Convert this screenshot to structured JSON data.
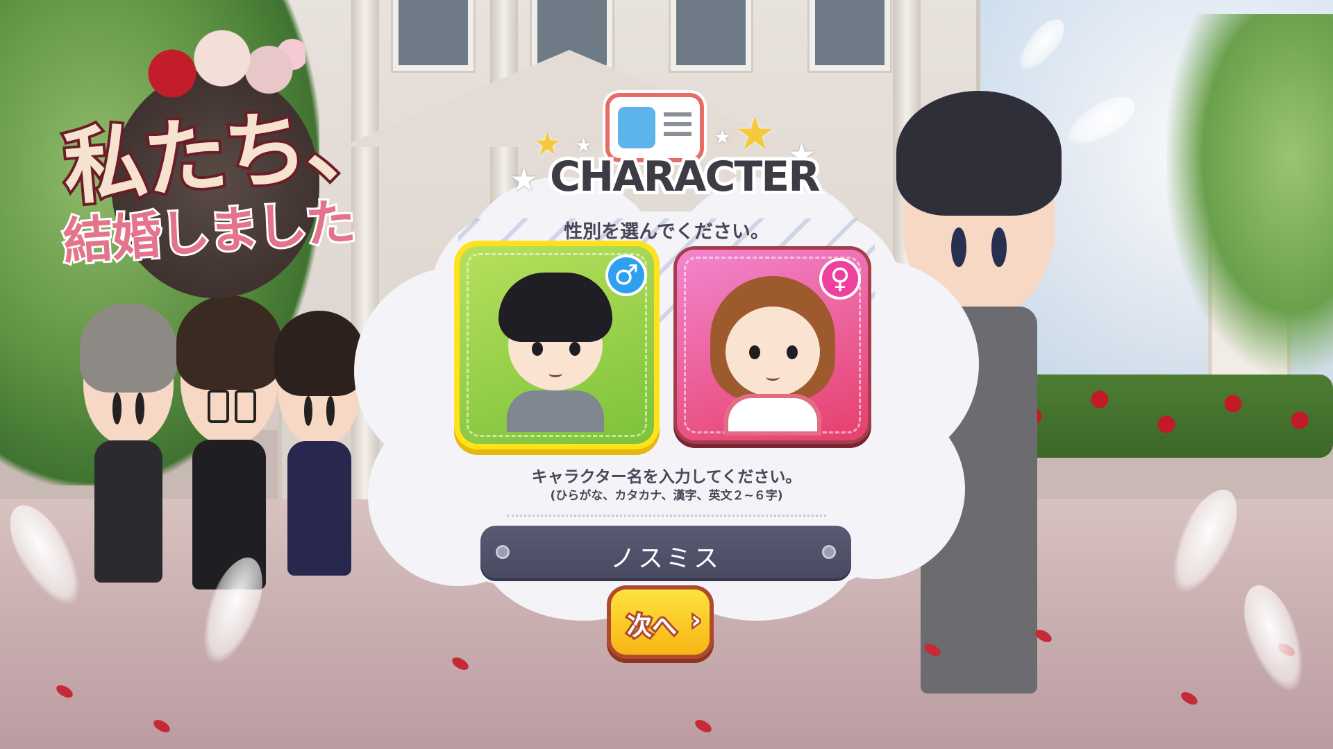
{
  "game": {
    "logo_line1": "私たち、",
    "logo_line2": "結婚しました"
  },
  "dialog": {
    "title": "CHARACTER",
    "gender_prompt": "性別を選んでください。",
    "genders": [
      {
        "label": "♂",
        "icon": "male-symbol-icon",
        "selected": true,
        "color": "#7cc23a"
      },
      {
        "label": "♀",
        "icon": "female-symbol-icon",
        "selected": false,
        "color": "#e63f6a"
      }
    ],
    "name_prompt": "キャラクター名を入力してください。",
    "name_hint": "(ひらがな、カタカナ、漢字、英文２~６字)",
    "name_value": "ノスミス",
    "next_label": "次へ",
    "next_icon": "chevron-right-icon"
  },
  "colors": {
    "accent_yellow": "#ffe21c",
    "button_yellow": "#f7b515",
    "field_dark": "#48485f"
  }
}
